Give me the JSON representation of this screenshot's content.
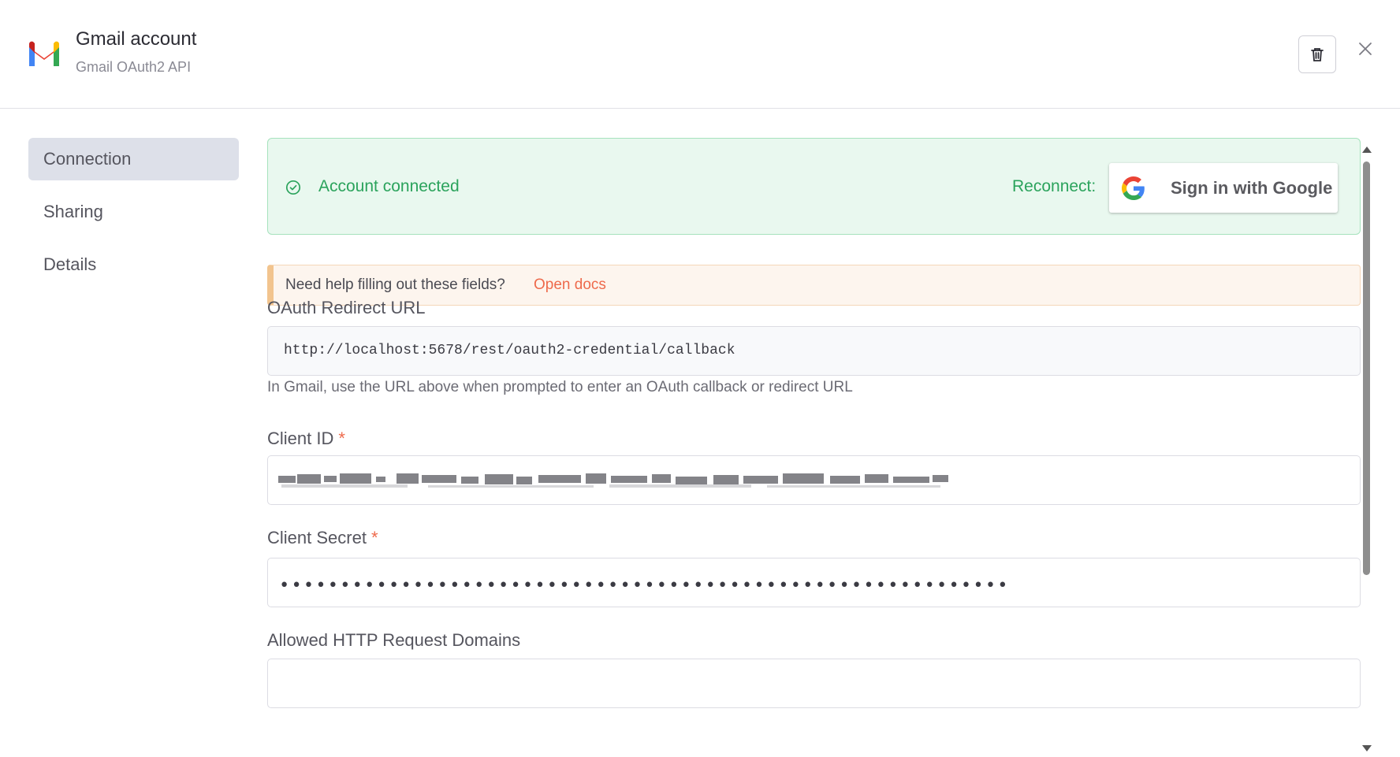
{
  "header": {
    "title": "Gmail account",
    "subtitle": "Gmail OAuth2 API",
    "logo_icon": "gmail-logo-icon",
    "delete_icon": "trash-icon",
    "close_icon": "close-icon"
  },
  "sidebar": {
    "items": [
      {
        "label": "Connection",
        "active": true
      },
      {
        "label": "Sharing",
        "active": false
      },
      {
        "label": "Details",
        "active": false
      }
    ]
  },
  "connection": {
    "status_text": "Account connected",
    "status_icon": "check-circle-icon",
    "reconnect_label": "Reconnect:",
    "google_button_label": "Sign in with Google",
    "help_text": "Need help filling out these fields?",
    "help_link": "Open docs",
    "redirect": {
      "label": "OAuth Redirect URL",
      "value": "http://localhost:5678/rest/oauth2-credential/callback",
      "hint": "In Gmail, use the URL above when prompted to enter an OAuth callback or redirect URL"
    },
    "client_id": {
      "label": "Client ID",
      "required_mark": "*"
    },
    "client_secret": {
      "label": "Client Secret",
      "required_mark": "*",
      "masked_value": "••••••••••••••••••••••••••••••••••••••••••••••••••••••••••••"
    },
    "allowed_domains": {
      "label": "Allowed HTTP Request Domains"
    }
  },
  "colors": {
    "success": "#2ba35c",
    "success_bg": "#e9f8ef",
    "warning_bg": "#fdf5ee",
    "link": "#ee6a4c",
    "active_nav_bg": "#dde0e9"
  }
}
